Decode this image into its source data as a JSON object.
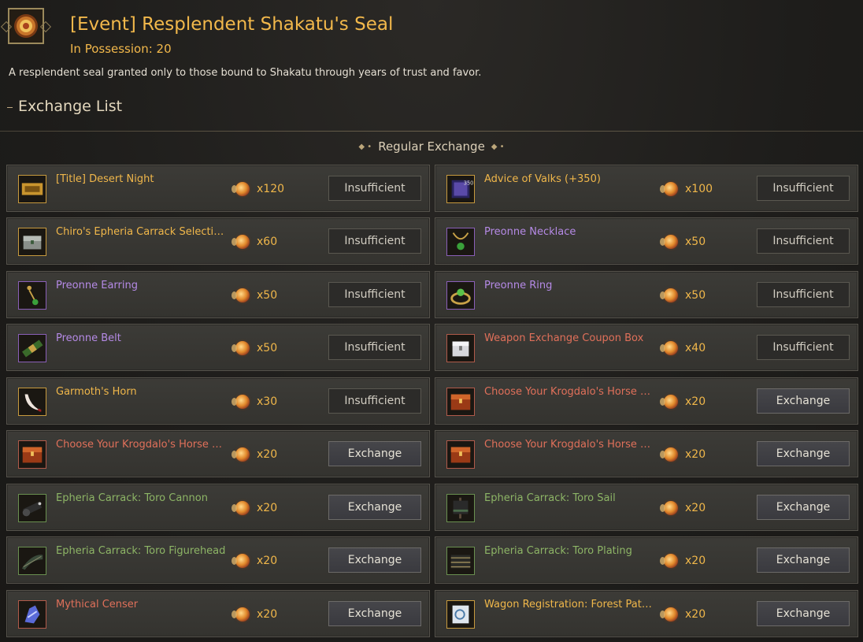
{
  "header": {
    "title": "[Event] Resplendent Shakatu's Seal",
    "possession": "In Possession: 20",
    "description": "A resplendent seal granted only to those bound to Shakatu through years of trust and favor.",
    "exchange_list_label": "Exchange List",
    "section_title": "Regular Exchange",
    "seal_icon": "resplendent-seal-icon"
  },
  "colors": {
    "gold": "#f0b74a",
    "purple": "#b58ae6",
    "red": "#e0705a",
    "green": "#8db566"
  },
  "items": [
    {
      "name": "[Title] Desert Night",
      "grade": "gold",
      "icon": "title-scroll-icon",
      "cost": "x120",
      "button": "Insufficient",
      "state": "insufficient"
    },
    {
      "name": "Advice of Valks (+350)",
      "grade": "gold",
      "icon": "valks-book-icon",
      "cost": "x100",
      "button": "Insufficient",
      "state": "insufficient"
    },
    {
      "name": "Chiro's Epheria Carrack Selection Box",
      "grade": "gold",
      "icon": "chest-icon",
      "cost": "x60",
      "button": "Insufficient",
      "state": "insufficient"
    },
    {
      "name": "Preonne Necklace",
      "grade": "purple",
      "icon": "necklace-icon",
      "cost": "x50",
      "button": "Insufficient",
      "state": "insufficient"
    },
    {
      "name": "Preonne Earring",
      "grade": "purple",
      "icon": "earring-icon",
      "cost": "x50",
      "button": "Insufficient",
      "state": "insufficient"
    },
    {
      "name": "Preonne Ring",
      "grade": "purple",
      "icon": "ring-icon",
      "cost": "x50",
      "button": "Insufficient",
      "state": "insufficient"
    },
    {
      "name": "Preonne Belt",
      "grade": "purple",
      "icon": "belt-icon",
      "cost": "x50",
      "button": "Insufficient",
      "state": "insufficient"
    },
    {
      "name": "Weapon Exchange Coupon Box",
      "grade": "red",
      "icon": "coupon-box-icon",
      "cost": "x40",
      "button": "Insufficient",
      "state": "insufficient"
    },
    {
      "name": "Garmoth's Horn",
      "grade": "gold",
      "icon": "horn-icon",
      "cost": "x30",
      "button": "Insufficient",
      "state": "insufficient"
    },
    {
      "name": "Choose Your Krogdalo's Horse Gear Box",
      "grade": "red",
      "icon": "treasure-chest-icon",
      "cost": "x20",
      "button": "Exchange",
      "state": "exchange"
    },
    {
      "name": "Choose Your Krogdalo's Horse Gear Box",
      "grade": "red",
      "icon": "treasure-chest-icon",
      "cost": "x20",
      "button": "Exchange",
      "state": "exchange"
    },
    {
      "name": "Choose Your Krogdalo's Horse Gear Box",
      "grade": "red",
      "icon": "treasure-chest-icon",
      "cost": "x20",
      "button": "Exchange",
      "state": "exchange"
    },
    {
      "name": "Epheria Carrack: Toro Cannon",
      "grade": "green",
      "icon": "cannon-icon",
      "cost": "x20",
      "button": "Exchange",
      "state": "exchange"
    },
    {
      "name": "Epheria Carrack: Toro Sail",
      "grade": "green",
      "icon": "sail-icon",
      "cost": "x20",
      "button": "Exchange",
      "state": "exchange"
    },
    {
      "name": "Epheria Carrack: Toro Figurehead",
      "grade": "green",
      "icon": "figurehead-icon",
      "cost": "x20",
      "button": "Exchange",
      "state": "exchange"
    },
    {
      "name": "Epheria Carrack: Toro Plating",
      "grade": "green",
      "icon": "plating-icon",
      "cost": "x20",
      "button": "Exchange",
      "state": "exchange"
    },
    {
      "name": "Mythical Censer",
      "grade": "red",
      "icon": "censer-icon",
      "cost": "x20",
      "button": "Exchange",
      "state": "exchange"
    },
    {
      "name": "Wagon Registration: Forest Path Wagon",
      "grade": "gold",
      "icon": "registration-scroll-icon",
      "cost": "x20",
      "button": "Exchange",
      "state": "exchange"
    }
  ]
}
